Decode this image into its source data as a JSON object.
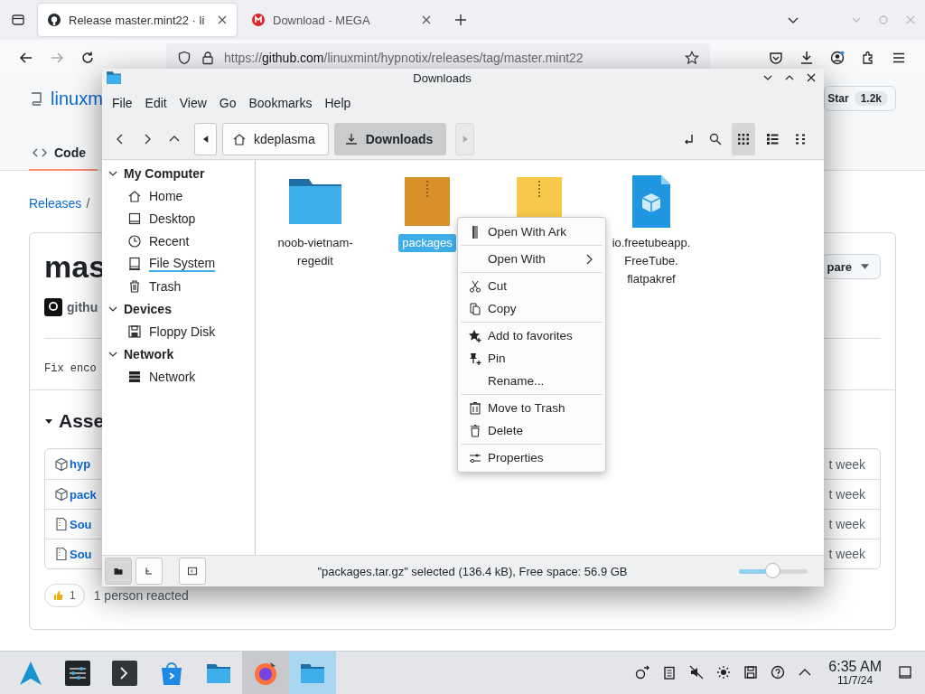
{
  "browser": {
    "tabs": [
      {
        "title": "Release master.mint22 · li",
        "selected": true
      },
      {
        "title": "Download - MEGA",
        "selected": false
      }
    ],
    "url": {
      "scheme": "https://",
      "host": "github.com",
      "path": "/linuxmint/hypnotix/releases/tag/master.mint22"
    },
    "page": {
      "repo": "linuxm",
      "star_label": "Star",
      "star_count": "1.2k",
      "nav_tab": "Code",
      "breadcrumb_link": "Releases",
      "breadcrumb_rest": "/",
      "title": "mas",
      "compare": "pare",
      "author": "githu",
      "body": "Fix enco",
      "assets_heading": "Asse",
      "assets": [
        {
          "name": "hyp",
          "kind": "package",
          "time": "t week"
        },
        {
          "name": "pack",
          "kind": "package",
          "time": "t week"
        },
        {
          "name": "Sou",
          "kind": "source",
          "time": "t week"
        },
        {
          "name": "Sou",
          "kind": "source",
          "time": "t week"
        }
      ],
      "reaction_count": "1",
      "reaction_text": "1 person reacted"
    }
  },
  "file_manager": {
    "window": {
      "title": "Downloads"
    },
    "menu": [
      "File",
      "Edit",
      "View",
      "Go",
      "Bookmarks",
      "Help"
    ],
    "breadcrumb": [
      {
        "label": "kdeplasma",
        "selected": false
      },
      {
        "label": "Downloads",
        "selected": true
      }
    ],
    "views": [
      {
        "selected": true
      },
      {
        "selected": false
      },
      {
        "selected": false
      }
    ],
    "places": [
      {
        "label": "My Computer",
        "expanded": true,
        "children": [
          {
            "label": "Home",
            "hovered": false
          },
          {
            "label": "Desktop",
            "hovered": false
          },
          {
            "label": "Recent",
            "hovered": false
          },
          {
            "label": "File System",
            "hovered": true
          },
          {
            "label": "Trash",
            "hovered": false
          }
        ]
      },
      {
        "label": "Devices",
        "expanded": true,
        "children": [
          {
            "label": "Floppy Disk",
            "hovered": false
          }
        ]
      },
      {
        "label": "Network",
        "expanded": true,
        "children": [
          {
            "label": "Network",
            "hovered": false
          }
        ]
      }
    ],
    "files": [
      {
        "name_lines": [
          "noob-vietnam-",
          "regedit"
        ],
        "kind": "folder",
        "selected": false
      },
      {
        "name_lines": [
          "packages"
        ],
        "kind": "tarball",
        "selected": true
      },
      {
        "kind": "zip",
        "selected": false
      },
      {
        "name_lines": [
          "io.freetubeapp.",
          "FreeTube.",
          "flatpakref"
        ],
        "kind": "flatpak",
        "selected": false
      }
    ],
    "panel_buttons": [
      {
        "selected": true
      },
      {
        "selected": false
      },
      {
        "selected": false
      }
    ],
    "status": {
      "text": "\"packages.tar.gz\" selected (136.4 kB), Free space: 56.9 GB",
      "zoom": {
        "level": 0.5
      }
    },
    "context_menu": {
      "sections": [
        [
          {
            "label": "Open With Ark",
            "submenu": false
          }
        ],
        [
          {
            "label": "Open With",
            "submenu": true
          }
        ],
        [
          {
            "label": "Cut",
            "submenu": false
          },
          {
            "label": "Copy",
            "submenu": false
          }
        ],
        [
          {
            "label": "Add to favorites",
            "submenu": false
          },
          {
            "label": "Pin",
            "submenu": false
          },
          {
            "label": "Rename...",
            "submenu": false
          }
        ],
        [
          {
            "label": "Move to Trash",
            "submenu": false
          },
          {
            "label": "Delete",
            "submenu": false
          }
        ],
        [
          {
            "label": "Properties",
            "submenu": false
          }
        ]
      ]
    }
  },
  "taskbar": {
    "tasks": [
      {
        "open": false,
        "selected": false
      },
      {
        "open": false,
        "selected": false
      },
      {
        "open": false,
        "selected": false
      },
      {
        "open": false,
        "selected": false
      },
      {
        "open": false,
        "selected": false
      },
      {
        "open": true,
        "selected": false
      },
      {
        "open": true,
        "selected": true
      }
    ],
    "clock": {
      "time": "6:35 AM",
      "date": "11/7/24"
    }
  }
}
